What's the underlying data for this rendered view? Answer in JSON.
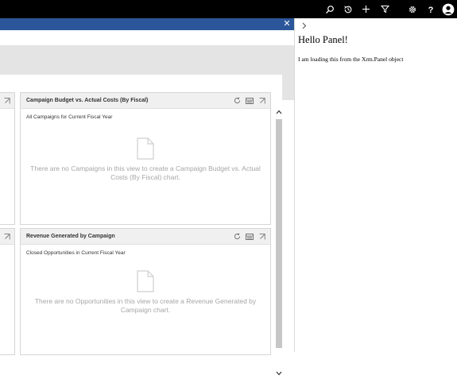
{
  "top_nav": {
    "icons": [
      "search-icon",
      "recent-history-icon",
      "quick-create-plus-icon",
      "advanced-filter-icon",
      "settings-gear-icon",
      "help-question-icon",
      "user-avatar-icon"
    ]
  },
  "dialog_bar": {
    "close_label": "✕",
    "color": "#2b579a"
  },
  "dashboard": {
    "cards": [
      {
        "title": "Campaign Budget vs. Actual Costs (By Fiscal)",
        "view": "All Campaigns for Current Fiscal Year",
        "empty_message": "There are no Campaigns in this view to create a Campaign Budget vs. Actual Costs (By Fiscal) chart.",
        "actions": [
          "refresh-icon",
          "view-records-icon",
          "expand-chart-icon"
        ]
      },
      {
        "title": "Revenue Generated by Campaign",
        "view": "Closed Opportunities in Current Fiscal Year",
        "empty_message": "There are no Opportunities in this view to create a Revenue Generated by Campaign chart.",
        "actions": [
          "refresh-icon",
          "view-records-icon",
          "expand-chart-icon"
        ]
      }
    ]
  },
  "side_panel": {
    "collapse_label": "›",
    "heading": "Hello Panel!",
    "body": "I am loading this from the Xrm.Panel object"
  }
}
